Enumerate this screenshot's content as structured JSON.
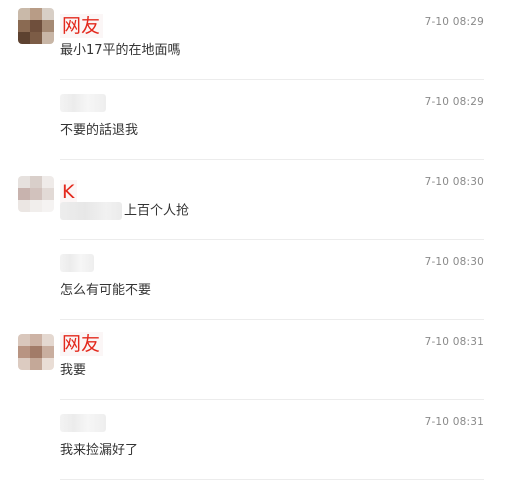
{
  "comments": [
    {
      "nickname": "网友",
      "time": "7-10 08:29",
      "text": "最小17平的在地面嗎"
    },
    {
      "nickname": "",
      "time": "7-10 08:29",
      "text": "不要的話退我"
    },
    {
      "nickname": "K",
      "time": "7-10 08:30",
      "text": "上百个人抢"
    },
    {
      "nickname": "",
      "time": "7-10 08:30",
      "text": "怎么有可能不要"
    },
    {
      "nickname": "网友",
      "time": "7-10 08:31",
      "text": "我要"
    },
    {
      "nickname": "",
      "time": "7-10 08:31",
      "text": "我来捡漏好了"
    }
  ],
  "colors": {
    "nickname": "#e3291d",
    "timestamp": "#8a8a8a",
    "text": "#333333",
    "divider": "#ececec"
  }
}
